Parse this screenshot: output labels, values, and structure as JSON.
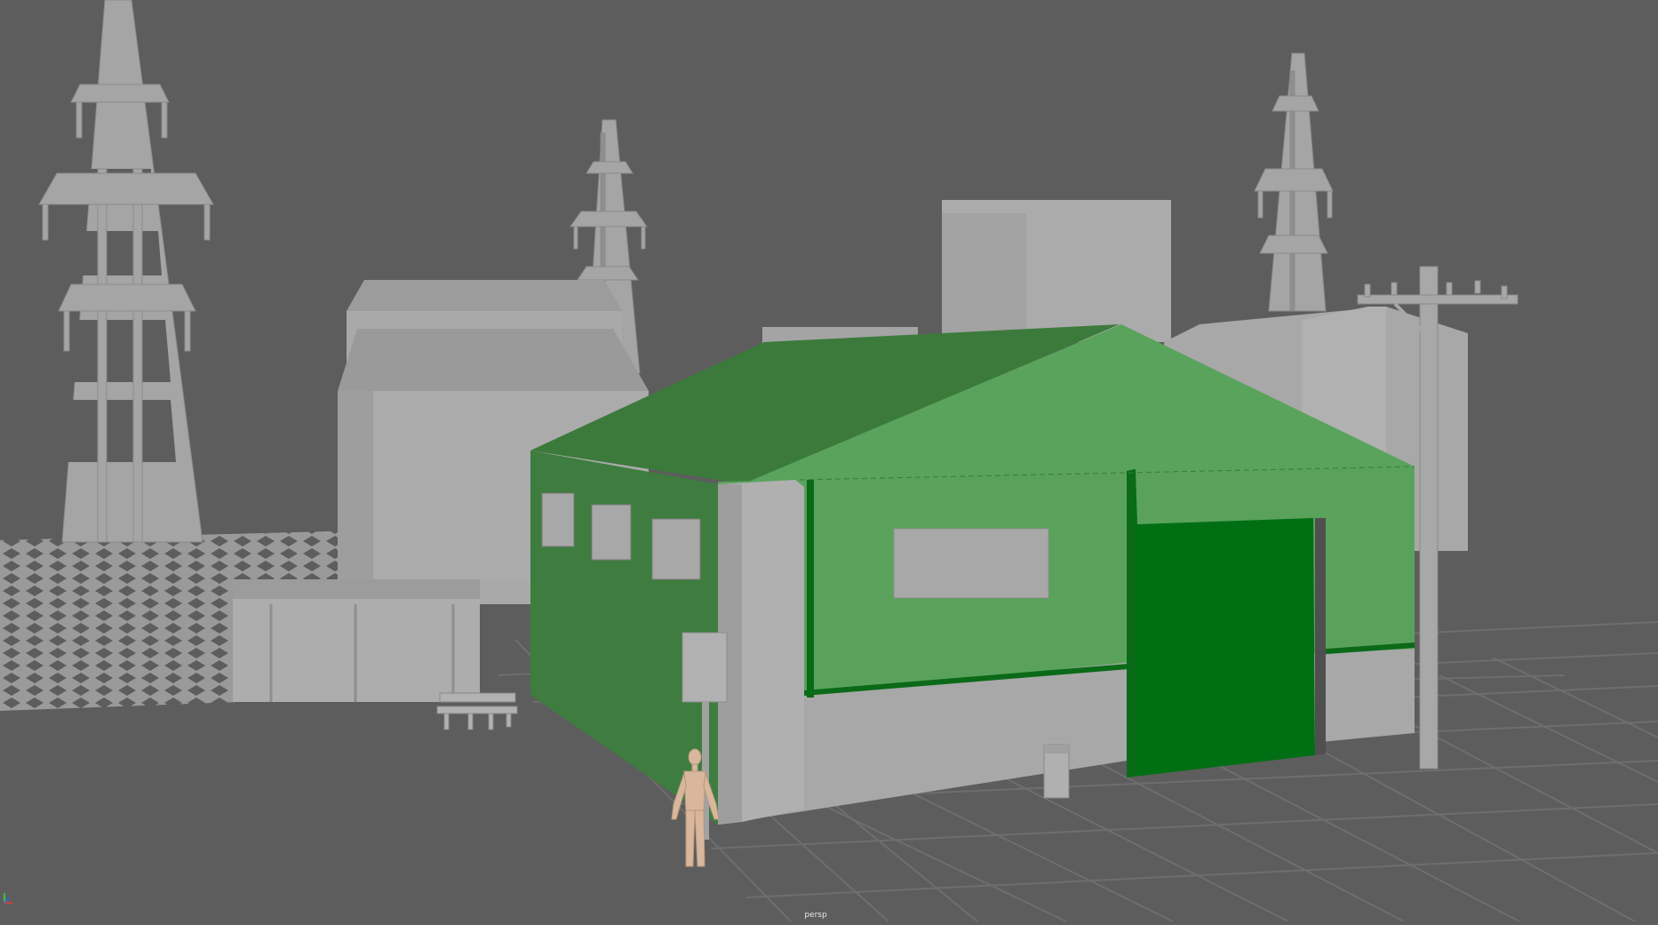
{
  "viewport": {
    "camera_name": "persp",
    "colors": {
      "background": "#5d5d5d",
      "ground_grid": "#6c6c6c",
      "building_gray": "#a8a8a8",
      "roof_green_dark": "#3a7c3f",
      "roof_green_light": "#5aa35f",
      "wall_green": "#58a35c",
      "door_green": "#006f14"
    },
    "objects": [
      "power-tower-left",
      "power-tower-middle",
      "power-tower-right",
      "chain-link-fence",
      "gray-warehouse-back",
      "gray-tall-block",
      "gray-building-right",
      "low-gray-shed",
      "bench",
      "green-warehouse",
      "sign-post",
      "utility-pole",
      "human-reference-figure",
      "electrical-box"
    ]
  }
}
